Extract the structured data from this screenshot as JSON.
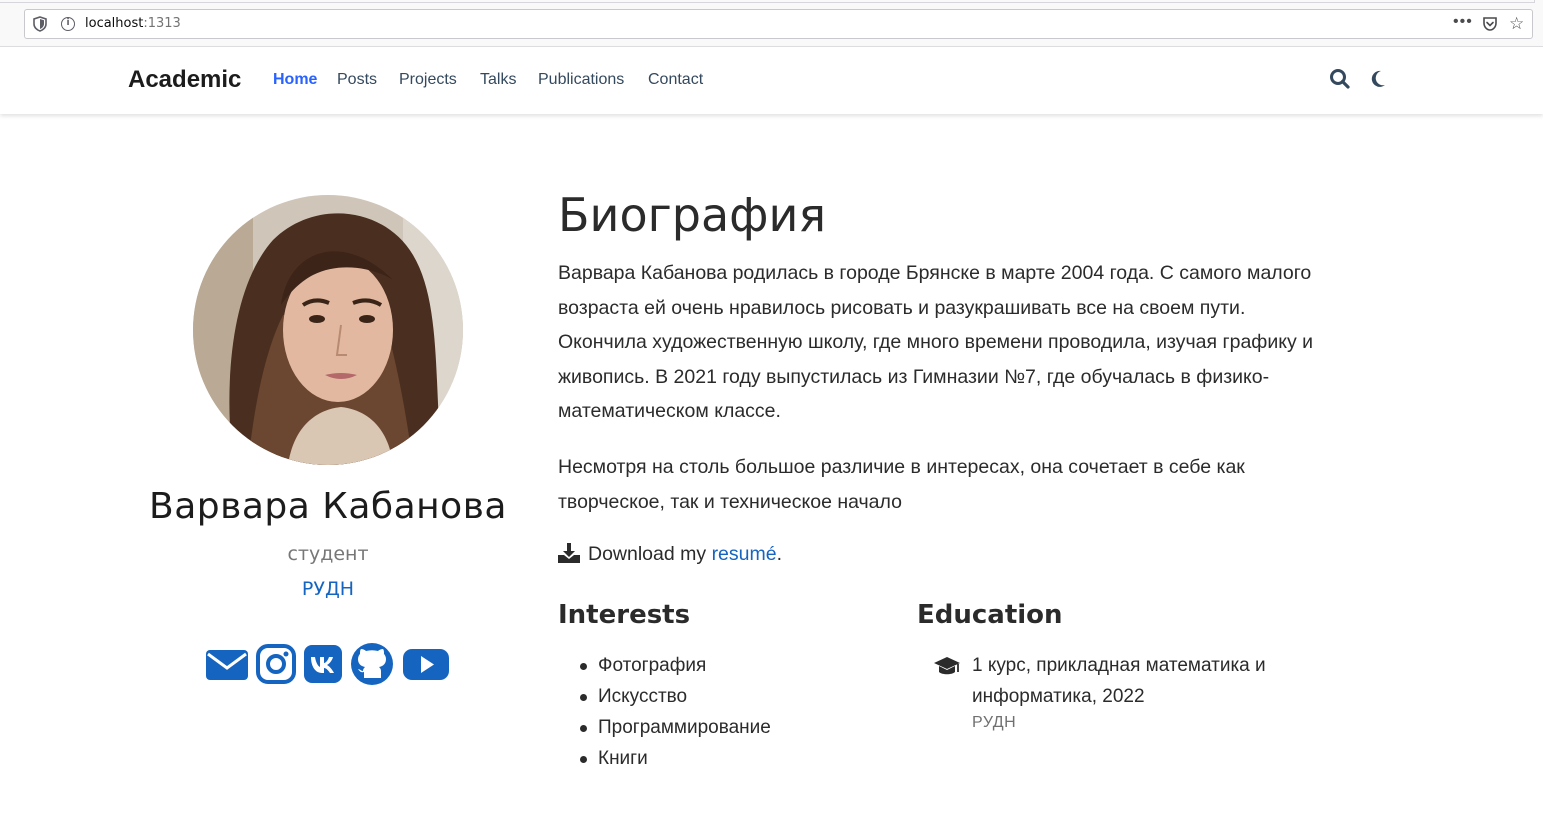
{
  "browser": {
    "url_host": "localhost",
    "url_port": ":1313"
  },
  "navbar": {
    "brand": "Academic",
    "items": [
      {
        "label": "Home",
        "active": true
      },
      {
        "label": "Posts"
      },
      {
        "label": "Projects"
      },
      {
        "label": "Talks"
      },
      {
        "label": "Publications"
      },
      {
        "label": "Contact"
      }
    ],
    "icons": [
      "search-icon",
      "moon-icon"
    ]
  },
  "profile": {
    "name": "Варвара Кабанова",
    "role": "студент",
    "organization": "РУДН",
    "social": [
      "envelope-icon",
      "instagram-icon",
      "vk-icon",
      "github-icon",
      "youtube-icon"
    ]
  },
  "biography": {
    "title": "Биография",
    "paragraph1_lines": [
      "Варвара Кабанова родилась в городе Брянске в марте 2004 года. С самого малого",
      "возраста ей очень нравилось рисовать и разукрашивать все на своем пути.",
      "Окончила художественную школу, где много времени проводила, изучая графику и",
      "живопись. В 2021 году выпустилась из Гимназии №7, где обучалась в физико-",
      "математическом классе."
    ],
    "paragraph2_lines": [
      "Несмотря на столь большое различие в интересах, она сочетает в себе как",
      "творческое, так и техническое начало"
    ],
    "download_prefix": "Download my",
    "download_link": "resumé",
    "download_suffix": "."
  },
  "interests": {
    "title": "Interests",
    "items": [
      "Фотография",
      "Искусство",
      "Программирование",
      "Книги"
    ]
  },
  "education": {
    "title": "Education",
    "course_lines": [
      "1 курс, прикладная математика и",
      "информатика, 2022"
    ],
    "institution": "РУДН"
  },
  "colors": {
    "link": "#1565c0",
    "nav_active": "#2962ff",
    "social": "#1565c0",
    "text": "#2b2b2b"
  }
}
